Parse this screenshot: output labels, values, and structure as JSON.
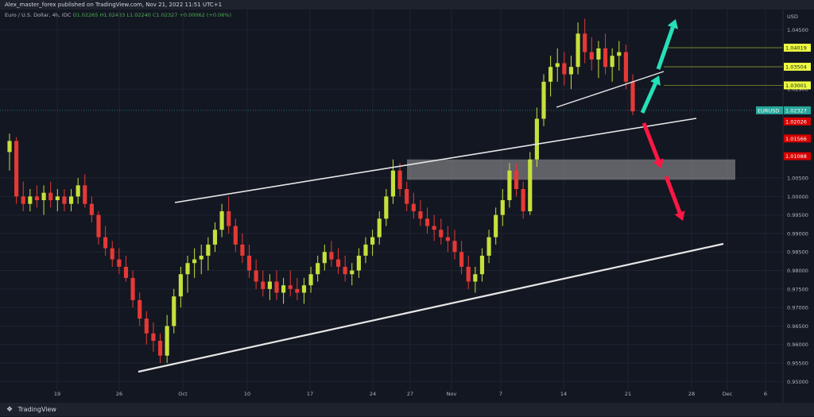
{
  "header": {
    "publisher_line": "Alex_master_forex published on TradingView.com, Nov 21, 2022 11:51 UTC+1"
  },
  "legend": {
    "symbol": "Euro / U.S. Dollar, 4h, IDC",
    "open": "O1.02265",
    "high": "H1.02433",
    "low": "L1.02240",
    "close": "C1.02327",
    "change": "+0.00062 (+0.06%)"
  },
  "footer": {
    "brand": "TradingView",
    "logo": "tv-logo-icon"
  },
  "colors": {
    "background": "#131722",
    "bull": "#c6e03c",
    "bear": "#e53935",
    "trendline": "#e6e6e6",
    "arrow_up": "#26e0b8",
    "arrow_down": "#ff1744",
    "zone": "#9e9e9e",
    "level_line": "#8a9a2e"
  },
  "chart_data": {
    "type": "candlestick",
    "title": "",
    "currency": "USD",
    "ticker_badge": "EURUSD",
    "last_price": "1.02327",
    "y_axis": {
      "range": [
        0.9475,
        1.0505
      ],
      "ticks": [
        "1.04500",
        "1.02900",
        "1.00500",
        "1.00000",
        "0.99500",
        "0.99000",
        "0.98500",
        "0.98000",
        "0.97500",
        "0.97000",
        "0.96500",
        "0.96000",
        "0.95500",
        "0.95000"
      ]
    },
    "x_axis": {
      "ticks": [
        "19",
        "26",
        "Oct",
        "10",
        "17",
        "24",
        "27",
        "Nov",
        "7",
        "14",
        "21",
        "28",
        "Dec",
        "6"
      ]
    },
    "price_levels": [
      {
        "value": "1.04019",
        "style": "yellow"
      },
      {
        "value": "1.03504",
        "style": "yellow"
      },
      {
        "value": "1.03001",
        "style": "yellow"
      },
      {
        "value": "1.02026",
        "style": "red"
      },
      {
        "value": "1.01566",
        "style": "red"
      },
      {
        "value": "1.01088",
        "style": "red"
      }
    ],
    "support_zone": {
      "low": 1.0045,
      "high": 1.01
    },
    "series": [
      {
        "values": [
          [
            1.012,
            1.017,
            1.007,
            1.015
          ],
          [
            1.015,
            1.016,
            0.998,
            1.0
          ],
          [
            1.0,
            1.004,
            0.996,
            0.998
          ],
          [
            0.998,
            1.002,
            0.996,
            1.0
          ],
          [
            1.0,
            1.003,
            0.997,
            0.999
          ],
          [
            0.999,
            1.003,
            0.995,
            1.001
          ],
          [
            1.001,
            1.004,
            0.997,
            0.999
          ],
          [
            0.999,
            1.002,
            0.996,
            1.0
          ],
          [
            1.0,
            1.002,
            0.996,
            0.998
          ],
          [
            0.998,
            1.002,
            0.996,
            1.0
          ],
          [
            1.0,
            1.005,
            0.998,
            1.003
          ],
          [
            1.003,
            1.006,
            0.997,
            0.998
          ],
          [
            0.998,
            1.0,
            0.993,
            0.995
          ],
          [
            0.995,
            0.996,
            0.987,
            0.989
          ],
          [
            0.989,
            0.992,
            0.984,
            0.986
          ],
          [
            0.986,
            0.988,
            0.981,
            0.983
          ],
          [
            0.983,
            0.986,
            0.979,
            0.981
          ],
          [
            0.981,
            0.984,
            0.977,
            0.978
          ],
          [
            0.978,
            0.98,
            0.97,
            0.972
          ],
          [
            0.972,
            0.974,
            0.965,
            0.967
          ],
          [
            0.967,
            0.969,
            0.96,
            0.963
          ],
          [
            0.963,
            0.966,
            0.958,
            0.961
          ],
          [
            0.961,
            0.963,
            0.955,
            0.957
          ],
          [
            0.957,
            0.968,
            0.955,
            0.965
          ],
          [
            0.965,
            0.975,
            0.963,
            0.973
          ],
          [
            0.973,
            0.981,
            0.97,
            0.979
          ],
          [
            0.979,
            0.984,
            0.974,
            0.982
          ],
          [
            0.982,
            0.986,
            0.978,
            0.983
          ],
          [
            0.983,
            0.987,
            0.979,
            0.984
          ],
          [
            0.984,
            0.989,
            0.98,
            0.987
          ],
          [
            0.987,
            0.993,
            0.985,
            0.991
          ],
          [
            0.991,
            0.998,
            0.989,
            0.996
          ],
          [
            0.996,
            1.0,
            0.99,
            0.992
          ],
          [
            0.992,
            0.994,
            0.985,
            0.987
          ],
          [
            0.987,
            0.99,
            0.982,
            0.984
          ],
          [
            0.984,
            0.987,
            0.978,
            0.98
          ],
          [
            0.98,
            0.983,
            0.975,
            0.977
          ],
          [
            0.977,
            0.98,
            0.973,
            0.975
          ],
          [
            0.975,
            0.979,
            0.972,
            0.977
          ],
          [
            0.977,
            0.98,
            0.972,
            0.974
          ],
          [
            0.974,
            0.978,
            0.971,
            0.976
          ],
          [
            0.976,
            0.98,
            0.973,
            0.975
          ],
          [
            0.975,
            0.978,
            0.972,
            0.974
          ],
          [
            0.974,
            0.978,
            0.971,
            0.976
          ],
          [
            0.976,
            0.981,
            0.974,
            0.979
          ],
          [
            0.979,
            0.984,
            0.977,
            0.982
          ],
          [
            0.982,
            0.987,
            0.98,
            0.985
          ],
          [
            0.985,
            0.988,
            0.981,
            0.983
          ],
          [
            0.983,
            0.986,
            0.979,
            0.981
          ],
          [
            0.981,
            0.984,
            0.977,
            0.979
          ],
          [
            0.979,
            0.982,
            0.976,
            0.98
          ],
          [
            0.98,
            0.986,
            0.978,
            0.984
          ],
          [
            0.984,
            0.989,
            0.982,
            0.987
          ],
          [
            0.987,
            0.991,
            0.984,
            0.989
          ],
          [
            0.989,
            0.996,
            0.987,
            0.994
          ],
          [
            0.994,
            1.002,
            0.992,
            1.0
          ],
          [
            1.0,
            1.01,
            0.998,
            1.007
          ],
          [
            1.007,
            1.009,
            1.0,
            1.002
          ],
          [
            1.002,
            1.004,
            0.996,
            0.998
          ],
          [
            0.998,
            1.001,
            0.994,
            0.996
          ],
          [
            0.996,
            0.999,
            0.992,
            0.994
          ],
          [
            0.994,
            0.997,
            0.99,
            0.992
          ],
          [
            0.992,
            0.995,
            0.988,
            0.991
          ],
          [
            0.991,
            0.994,
            0.987,
            0.989
          ],
          [
            0.989,
            0.992,
            0.985,
            0.988
          ],
          [
            0.988,
            0.991,
            0.983,
            0.985
          ],
          [
            0.985,
            0.988,
            0.979,
            0.981
          ],
          [
            0.981,
            0.984,
            0.975,
            0.977
          ],
          [
            0.977,
            0.981,
            0.974,
            0.979
          ],
          [
            0.979,
            0.986,
            0.977,
            0.984
          ],
          [
            0.984,
            0.991,
            0.982,
            0.989
          ],
          [
            0.989,
            0.997,
            0.987,
            0.995
          ],
          [
            0.995,
            1.002,
            0.992,
            0.999
          ],
          [
            0.999,
            1.009,
            0.997,
            1.007
          ],
          [
            1.007,
            1.009,
            1.0,
            1.002
          ],
          [
            1.002,
            1.004,
            0.994,
            0.996
          ],
          [
            0.996,
            1.012,
            0.995,
            1.01
          ],
          [
            1.01,
            1.024,
            1.008,
            1.021
          ],
          [
            1.021,
            1.033,
            1.019,
            1.031
          ],
          [
            1.031,
            1.038,
            1.027,
            1.035
          ],
          [
            1.035,
            1.04,
            1.031,
            1.036
          ],
          [
            1.036,
            1.039,
            1.03,
            1.033
          ],
          [
            1.033,
            1.038,
            1.029,
            1.035
          ],
          [
            1.035,
            1.047,
            1.033,
            1.044
          ],
          [
            1.044,
            1.048,
            1.036,
            1.039
          ],
          [
            1.039,
            1.043,
            1.034,
            1.037
          ],
          [
            1.037,
            1.042,
            1.032,
            1.04
          ],
          [
            1.04,
            1.044,
            1.033,
            1.035
          ],
          [
            1.035,
            1.04,
            1.031,
            1.038
          ],
          [
            1.038,
            1.042,
            1.034,
            1.039
          ],
          [
            1.039,
            1.041,
            1.029,
            1.031
          ],
          [
            1.031,
            1.033,
            1.022,
            1.023
          ]
        ]
      }
    ],
    "annotations": {
      "trendlines": "upper and lower channel lines, short support lines",
      "arrows": [
        "up",
        "up",
        "down",
        "down"
      ]
    }
  }
}
